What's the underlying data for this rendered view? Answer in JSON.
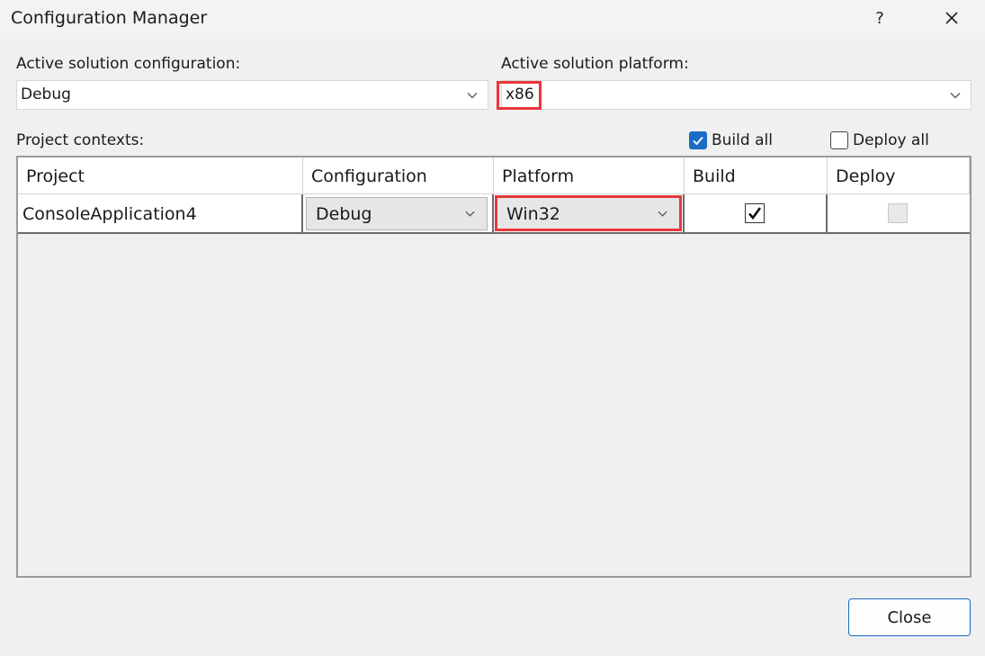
{
  "window": {
    "title": "Configuration Manager",
    "help_label": "?",
    "close_label": "✕"
  },
  "solution": {
    "config_label": "Active solution configuration:",
    "config_value": "Debug",
    "platform_label": "Active solution platform:",
    "platform_value": "x86"
  },
  "project_contexts_label": "Project contexts:",
  "build_all": {
    "label": "Build all",
    "checked": true
  },
  "deploy_all": {
    "label": "Deploy all",
    "checked": false
  },
  "table": {
    "columns": [
      "Project",
      "Configuration",
      "Platform",
      "Build",
      "Deploy"
    ],
    "rows": [
      {
        "project": "ConsoleApplication4",
        "configuration": "Debug",
        "platform": "Win32",
        "build": true,
        "deploy": false
      }
    ]
  },
  "footer": {
    "close_label": "Close"
  },
  "colors": {
    "accent": "#1a6cc4",
    "highlight": "#e8373c",
    "background": "#f0f0f0"
  }
}
